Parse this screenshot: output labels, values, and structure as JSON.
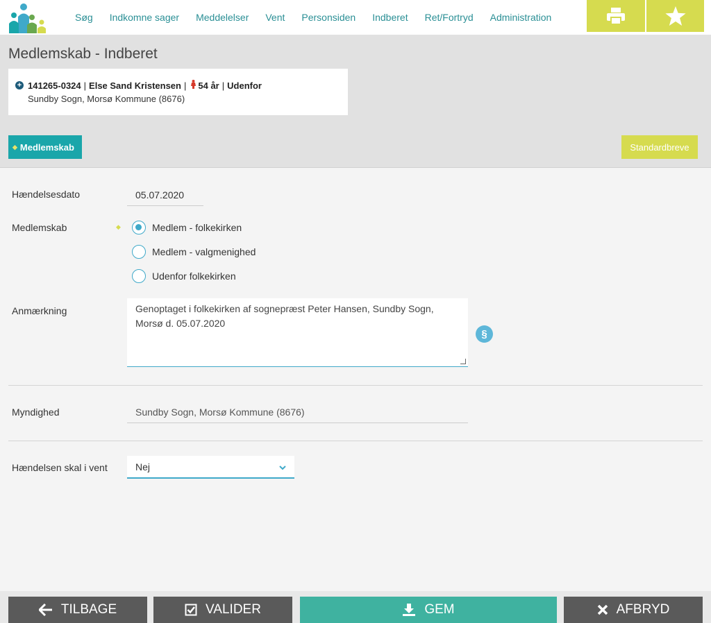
{
  "nav": {
    "items": [
      {
        "label": "Søg"
      },
      {
        "label": "Indkomne sager"
      },
      {
        "label": "Meddelelser"
      },
      {
        "label": "Vent"
      },
      {
        "label": "Personsiden"
      },
      {
        "label": "Indberet"
      },
      {
        "label": "Ret/Fortryd"
      },
      {
        "label": "Administration"
      }
    ],
    "print_icon": "printer-icon",
    "favorite_icon": "star-icon"
  },
  "header": {
    "title": "Medlemskab - Indberet",
    "person": {
      "cpr": "141265-0324",
      "name": "Else Sand Kristensen",
      "age": "54 år",
      "status": "Udenfor",
      "location": "Sundby Sogn, Morsø Kommune (8676)"
    },
    "tab_label": "Medlemskab",
    "standardbreve_label": "Standardbreve"
  },
  "form": {
    "date_label": "Hændelsesdato",
    "date_value": "05.07.2020",
    "membership_label": "Medlemskab",
    "membership_options": [
      {
        "label": "Medlem - folkekirken",
        "checked": true
      },
      {
        "label": "Medlem - valgmenighed",
        "checked": false
      },
      {
        "label": "Udenfor folkekirken",
        "checked": false
      }
    ],
    "note_label": "Anmærkning",
    "note_value": "Genoptaget i folkekirken af sognepræst Peter Hansen, Sundby Sogn, Morsø d. 05.07.2020",
    "paragraph_symbol": "§",
    "authority_label": "Myndighed",
    "authority_value": "Sundby Sogn, Morsø Kommune (8676)",
    "wait_label": "Hændelsen skal i vent",
    "wait_value": "Nej"
  },
  "actions": {
    "back": "TILBAGE",
    "validate": "VALIDER",
    "save": "GEM",
    "cancel": "AFBRYD"
  },
  "colors": {
    "teal": "#1aa6aa",
    "lime": "#d6db4f",
    "save_green": "#3fb2a0",
    "dark_button": "#5a5a5a",
    "link": "#2a8f95"
  }
}
